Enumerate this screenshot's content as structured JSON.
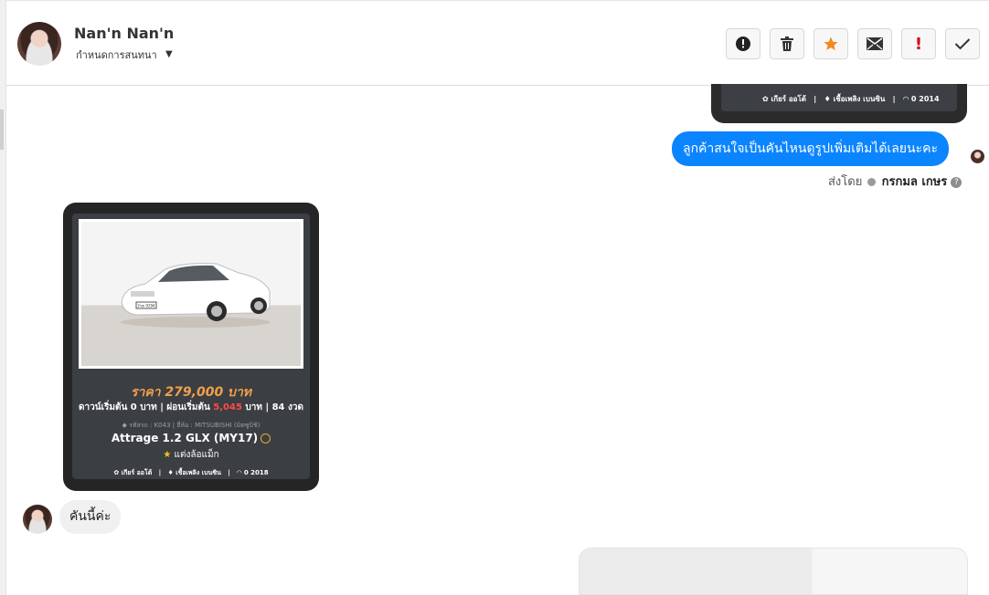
{
  "header": {
    "contact_name": "Nan'n Nan'n",
    "subtitle": "กำหนดการสนทนา",
    "caret_icon": "caret-down-icon",
    "actions": [
      {
        "name": "alert-circle-icon",
        "glyph": "!"
      },
      {
        "name": "trash-icon",
        "glyph": "🗑"
      },
      {
        "name": "star-icon",
        "glyph": "★"
      },
      {
        "name": "mail-icon",
        "glyph": "✉"
      },
      {
        "name": "exclamation-icon",
        "glyph": "!"
      },
      {
        "name": "check-icon",
        "glyph": "✓"
      }
    ],
    "colors": {
      "star": "#f08a24",
      "exclamation": "#d0021b"
    }
  },
  "prev_card": {
    "gear": "เกียร์ ออโต้",
    "fuel": "เชื้อเพลิง เบนซิน",
    "mileage": "0 2014"
  },
  "outgoing_message": {
    "text": "ลูกค้าสนใจเป็นคันไหนดูรูปเพิ่มเติมได้เลยนะคะ",
    "sent_prefix": "ส่งโดย",
    "sender": "กรกมล เกษร",
    "help_glyph": "?",
    "color": "#0b84ff"
  },
  "car_card": {
    "price": "ราคา 279,000 บาท",
    "terms_a": "ดาวน์เริ่มต้น 0 บาท | ผ่อนเริ่มต้น ",
    "monthly": "5,045",
    "terms_b": " บาท | 84 งวด",
    "codes": "รหัสรถ : K043 | ยี่ห้อ : MITSUBISHI (มิตซูบิชิ)",
    "model": "Attrage 1.2 GLX (MY17)",
    "feature_star": "★",
    "feature": "แต่งล้อแม็ก",
    "gear": "เกียร์ ออโต้",
    "fuel": "เชื้อเพลิง เบนซิน",
    "mileage": "0 2018",
    "plate": "2ขธ 9294",
    "colors": {
      "price": "#f0a04b",
      "monthly": "#ff4b4b"
    }
  },
  "incoming_message": {
    "text": "คันนี้ค่ะ"
  }
}
